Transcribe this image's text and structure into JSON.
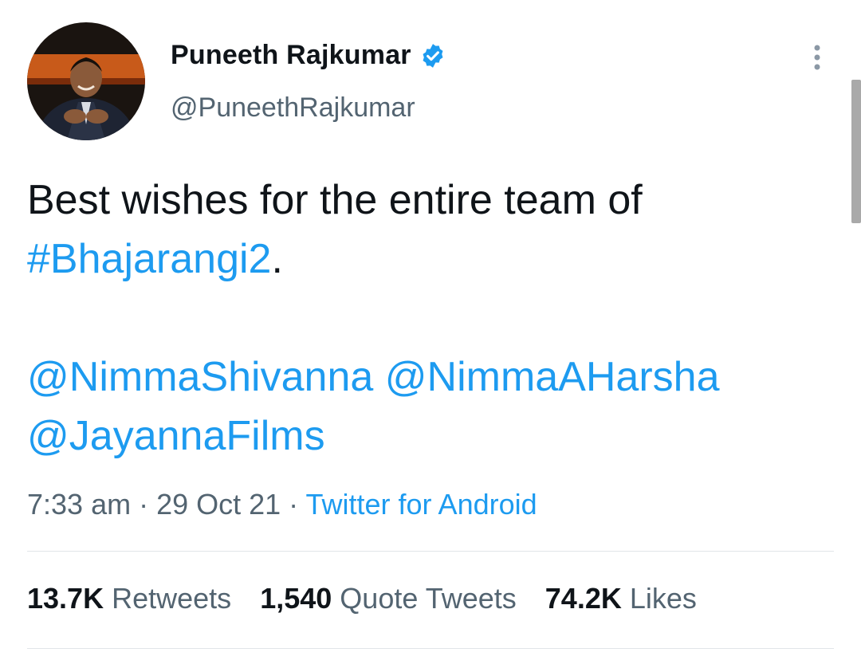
{
  "author": {
    "name": "Puneeth Rajkumar",
    "handle": "@PuneethRajkumar",
    "verified": true
  },
  "icons": {
    "verified": "verified-badge-icon",
    "more": "more-vertical-icon"
  },
  "tweet": {
    "line1": "Best wishes for the entire team of",
    "hashtag": "#Bhajarangi2",
    "hashtag_suffix": ".",
    "mention1": "@NimmaShivanna",
    "mention2": "@NimmaAHarsha",
    "mention3": "@JayannaFilms"
  },
  "meta": {
    "time": "7:33 am",
    "sep1": " · ",
    "date": "29 Oct 21",
    "sep2": " · ",
    "source": "Twitter for Android"
  },
  "stats": {
    "retweets_count": "13.7K",
    "retweets_label": "Retweets",
    "quotes_count": "1,540",
    "quotes_label": "Quote Tweets",
    "likes_count": "74.2K",
    "likes_label": "Likes"
  },
  "colors": {
    "link": "#1d9bf0",
    "text": "#0f1419",
    "secondary": "#536471"
  }
}
